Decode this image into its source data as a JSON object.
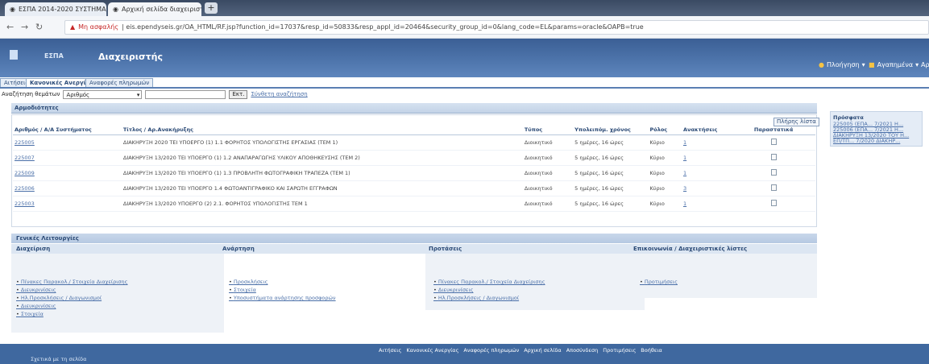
{
  "browser": {
    "tabs": [
      {
        "label": "ΕΣΠΑ 2014-2020 ΣΥΣΤΗΜΑ",
        "active": false
      },
      {
        "label": "Αρχική σελίδα διαχειριστή",
        "active": true
      }
    ],
    "url_warning": "Μη ασφαλής",
    "url": "eis.ependyseis.gr/OA_HTML/RF.jsp?function_id=17037&resp_id=50833&resp_appl_id=20464&security_group_id=0&lang_code=EL&params=oracle&OAPB=true"
  },
  "app": {
    "brand": "ΕΣΠΑ",
    "title": "Διαχειριστής",
    "favorites_label": "Πλοήγηση",
    "navigator_label": "Αγαπημένα",
    "extra_label": "Αρ"
  },
  "app_tabs": [
    "Αιτήσεις",
    "Κανονικές Ανεργίας",
    "Αναφορές πληρωμών"
  ],
  "search": {
    "label": "Αναζήτηση θεμάτων",
    "select_value": "Αριθμός",
    "go_label": "Εκτ.",
    "advanced_label": "Σύνθετη αναζήτηση"
  },
  "notifications": {
    "header": "Αρμοδιότητες",
    "all_button": "Πλήρης λίστα",
    "columns": [
      "Αριθμός / Α/Α Συστήματος",
      "Τίτλος / Αρ.Ανακήρυξης",
      "Τύπος",
      "Υπολειπόμ. χρόνος",
      "Ρόλος",
      "Ανακτήσεις",
      "Παραστατικά"
    ],
    "rows": [
      {
        "id": "225005",
        "title": "ΔΙΑΚΗΡΥΞΗ 2020 ΤΕΙ ΥΠΟΕΡΓΟ (1) 1.1 ΦΟΡΗΤΟΣ ΥΠΟΛΟΓΙΣΤΗΣ ΕΡΓΑΣΙΑΣ (ΤΕΜ 1)",
        "type": "Διοικητικό",
        "time": "5 ημέρες, 16 ώρες",
        "role": "Κύριο",
        "count": "1"
      },
      {
        "id": "225007",
        "title": "ΔΙΑΚΗΡΥΞΗ 13/2020 ΤΕΙ ΥΠΟΕΡΓΟ (1) 1.2 ΑΝΑΠΑΡΑΓΩΓΗΣ ΥΛΙΚΟΥ ΑΠΟΘΗΚΕΥΣΗΣ (ΤΕΜ 2)",
        "type": "Διοικητικό",
        "time": "5 ημέρες, 16 ώρες",
        "role": "Κύριο",
        "count": "1"
      },
      {
        "id": "225009",
        "title": "ΔΙΑΚΗΡΥΞΗ 13/2020 ΤΕΙ ΥΠΟΕΡΓΟ (1) 1.3 ΠΡΟΒΛΗΤΗ ΦΩΤΟΓΡΑΦΙΚΗ ΤΡΑΠΕΖΑ (ΤΕΜ 1)",
        "type": "Διοικητικό",
        "time": "5 ημέρες, 16 ώρες",
        "role": "Κύριο",
        "count": "1"
      },
      {
        "id": "225006",
        "title": "ΔΙΑΚΗΡΥΞΗ 13/2020 ΤΕΙ ΥΠΟΕΡΓΟ 1.4 ΦΩΤΟΑΝΤΙΓΡΑΦΙΚΟ ΚΑΙ ΣΑΡΩΤΗ ΕΓΓΡΑΦΩΝ",
        "type": "Διοικητικό",
        "time": "5 ημέρες, 16 ώρες",
        "role": "Κύριο",
        "count": "3"
      },
      {
        "id": "225003",
        "title": "ΔΙΑΚΗΡΥΞΗ 13/2020 ΥΠΟΕΡΓΟ (2) 2.1. ΦΟΡΗΤΟΣ ΥΠΟΛΟΓΙΣΤΗΣ ΤΕΜ 1",
        "type": "Διοικητικό",
        "time": "5 ημέρες, 16 ώρες",
        "role": "Κύριο",
        "count": "1"
      }
    ]
  },
  "sidebar": {
    "header": "Πρόσφατα",
    "links": [
      "225005 (ΕΠΑ... 7/2021 Η...",
      "225006 (ΕΠΑ... 7/2021 Η...",
      "ΔΙΑΚΗΡΥΞΗ 13/2020 ΤΟΥ Η...",
      "ΕΠ/ΤΠ... 7/2020 ΔΙΑΚΗΡ..."
    ]
  },
  "general_area": {
    "header": "Γενικές Λειτουργίες",
    "columns": [
      {
        "heading": "Διαχείριση",
        "links": [
          "Πίνακες Παρακολ./ Στοιχεία Διαχείρισης",
          "Διευκρινίσεις",
          "Ηλ.Προσκλήσεις / Διαγωνισμοί",
          "Διευκρινίσεις",
          "Στοιχεία"
        ]
      },
      {
        "heading": "Ανάρτηση",
        "links": [
          "Προσκλήσεις",
          "Στοιχεία",
          "Υποσυστήματα ανάρτησης προσφορών"
        ]
      },
      {
        "heading": "Προτάσεις",
        "links": [
          "Πίνακες Παρακολ./ Στοιχεία Διαχείρισης",
          "Διευκρινίσεις",
          "Ηλ.Προσκλήσεις / Διαγωνισμοί"
        ]
      },
      {
        "heading": "Επικοινωνία / Διαχειριστικές λίστες",
        "links": [
          "Προτιμήσεις"
        ]
      }
    ]
  },
  "footer": {
    "links": [
      "Αιτήσεις",
      "Κανονικές Ανεργίας",
      "Αναφορές πληρωμών",
      "Αρχική σελίδα",
      "Αποσύνδεση",
      "Προτιμήσεις",
      "Βοήθεια"
    ],
    "about": "Σχετικά με τη σελίδα"
  }
}
